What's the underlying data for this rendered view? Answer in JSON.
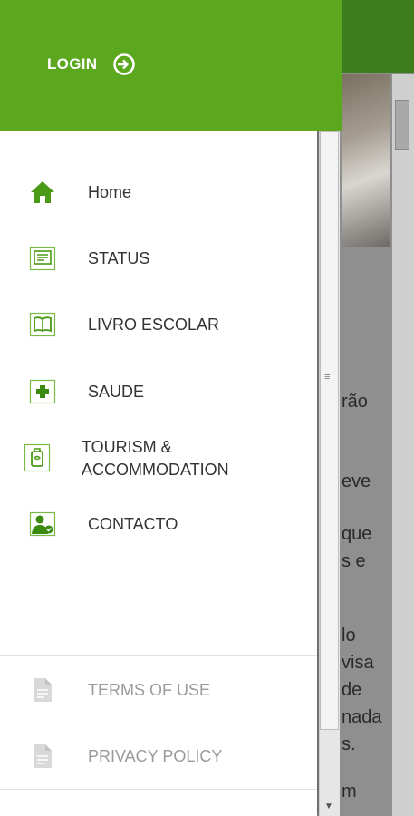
{
  "background": {
    "text_fragments": [
      "rão",
      "eve",
      "que",
      "s e",
      "lo",
      "visa",
      "de",
      "nada",
      "s.",
      "m"
    ]
  },
  "drawer": {
    "login_label": "LOGIN",
    "menu": [
      {
        "label": "Home",
        "icon": "home-icon"
      },
      {
        "label": "STATUS",
        "icon": "status-icon"
      },
      {
        "label": "LIVRO ESCOLAR",
        "icon": "book-icon"
      },
      {
        "label": "SAUDE",
        "icon": "health-plus-icon"
      },
      {
        "label": "TOURISM &",
        "label2": "ACCOMMODATION",
        "icon": "luggage-icon"
      },
      {
        "label": "CONTACTO",
        "icon": "contact-icon"
      }
    ],
    "footer": [
      {
        "label": "TERMS OF USE",
        "icon": "document-icon"
      },
      {
        "label": "PRIVACY POLICY",
        "icon": "document-icon"
      }
    ]
  },
  "colors": {
    "accent": "#5ba71e",
    "accent_dark": "#3e7d1c"
  }
}
